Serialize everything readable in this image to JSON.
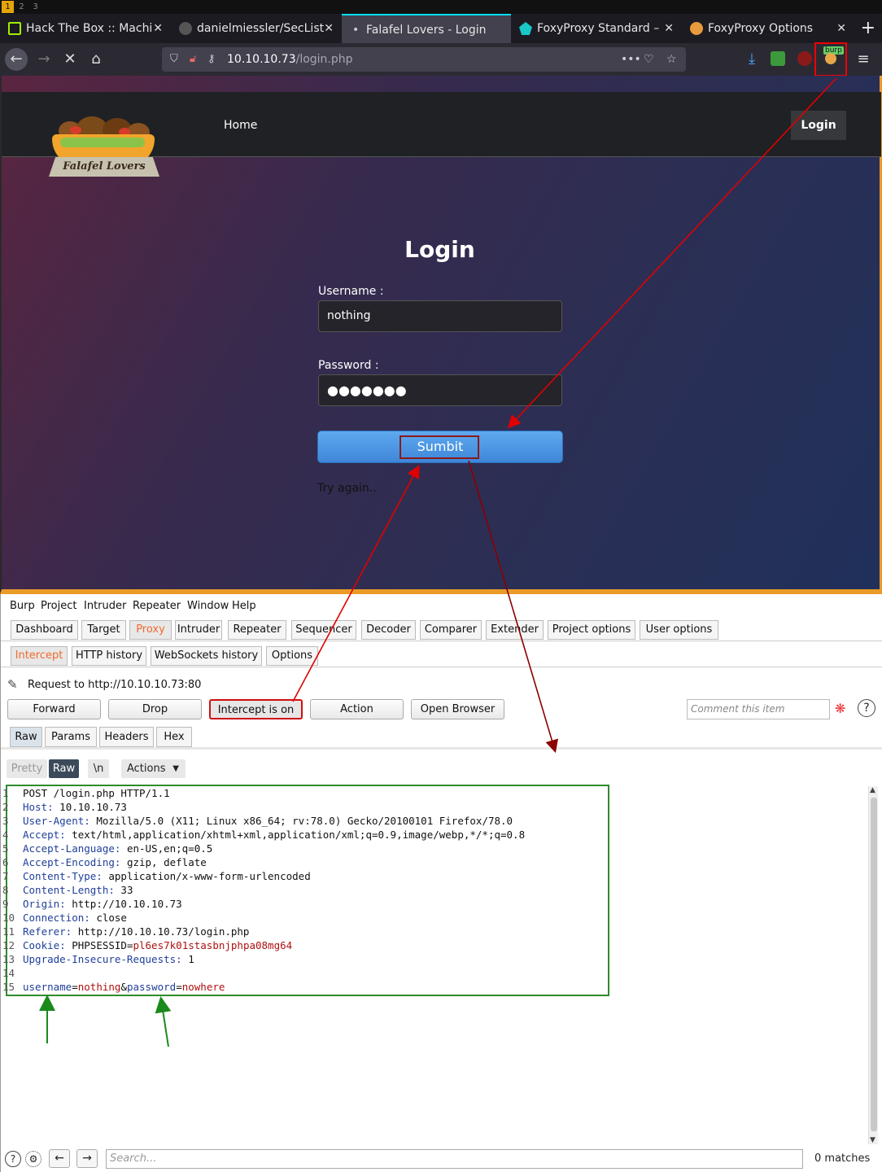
{
  "workspaces": [
    "1",
    "2",
    "3"
  ],
  "browser": {
    "tabs": [
      {
        "title": "Hack The Box :: Machi",
        "icon": "htb-cube-icon",
        "color": "#9fef00"
      },
      {
        "title": "danielmiessler/SecList",
        "icon": "github-icon",
        "color": "#cccccc"
      },
      {
        "title": "Falafel Lovers - Login",
        "icon": "loading-dot-icon",
        "color": "#e6e6e6"
      },
      {
        "title": "FoxyProxy Standard –",
        "icon": "foxyproxy-icon",
        "color": "#19c7c7"
      },
      {
        "title": "FoxyProxy Options",
        "icon": "foxyproxy-orange-icon",
        "color": "#e89a3c"
      }
    ],
    "url_host": "10.10.10.73",
    "url_path": "/login.php"
  },
  "site": {
    "logo_text": "Falafel Lovers",
    "nav_home": "Home",
    "nav_login": "Login",
    "title": "Login",
    "username_label": "Username :",
    "username_value": "nothing",
    "password_label": "Password :",
    "password_value": "●●●●●●●",
    "submit_label": "Sumbit",
    "message": "Try again.."
  },
  "burp": {
    "menu": [
      "Burp",
      "Project",
      "Intruder",
      "Repeater",
      "Window",
      "Help"
    ],
    "main_tabs": [
      "Dashboard",
      "Target",
      "Proxy",
      "Intruder",
      "Repeater",
      "Sequencer",
      "Decoder",
      "Comparer",
      "Extender",
      "Project options",
      "User options"
    ],
    "proxy_tabs": [
      "Intercept",
      "HTTP history",
      "WebSockets history",
      "Options"
    ],
    "request_label": "Request to http://10.10.10.73:80",
    "buttons": {
      "forward": "Forward",
      "drop": "Drop",
      "intercept": "Intercept is on",
      "action": "Action",
      "open_browser": "Open Browser"
    },
    "comment_placeholder": "Comment this item",
    "view_tabs": [
      "Raw",
      "Params",
      "Headers",
      "Hex"
    ],
    "editor_buttons": {
      "pretty": "Pretty",
      "raw": "Raw",
      "newline": "\\n",
      "actions": "Actions"
    },
    "request_lines": [
      {
        "n": "1",
        "plain": "POST /login.php HTTP/1.1"
      },
      {
        "n": "2",
        "key": "Host:",
        "value": " 10.10.10.73"
      },
      {
        "n": "3",
        "key": "User-Agent:",
        "value": " Mozilla/5.0 (X11; Linux x86_64; rv:78.0) Gecko/20100101 Firefox/78.0"
      },
      {
        "n": "4",
        "key": "Accept:",
        "value": " text/html,application/xhtml+xml,application/xml;q=0.9,image/webp,*/*;q=0.8"
      },
      {
        "n": "5",
        "key": "Accept-Language:",
        "value": " en-US,en;q=0.5"
      },
      {
        "n": "6",
        "key": "Accept-Encoding:",
        "value": " gzip, deflate"
      },
      {
        "n": "7",
        "key": "Content-Type:",
        "value": " application/x-www-form-urlencoded"
      },
      {
        "n": "8",
        "key": "Content-Length:",
        "value": " 33"
      },
      {
        "n": "9",
        "key": "Origin:",
        "value": " http://10.10.10.73"
      },
      {
        "n": "10",
        "key": "Connection:",
        "value": " close"
      },
      {
        "n": "11",
        "key": "Referer:",
        "value": " http://10.10.10.73/login.php"
      },
      {
        "n": "12",
        "key": "Cookie:",
        "value": " PHPSESSID=",
        "extra": "pl6es7k01stasbnjphpa08mg64"
      },
      {
        "n": "13",
        "key": "Upgrade-Insecure-Requests:",
        "value": " 1"
      },
      {
        "n": "14",
        "plain": ""
      },
      {
        "n": "15",
        "body": [
          {
            "t": "username",
            "c": "hk"
          },
          {
            "t": "=",
            "c": "val"
          },
          {
            "t": "nothing",
            "c": "pv"
          },
          {
            "t": "&",
            "c": "val"
          },
          {
            "t": "password",
            "c": "hk"
          },
          {
            "t": "=",
            "c": "val"
          },
          {
            "t": "nowhere",
            "c": "pv"
          }
        ]
      }
    ],
    "search_placeholder": "Search...",
    "matches": "0 matches"
  },
  "colors": {
    "burp_accent": "#f06a2b",
    "annotation_red": "#e00000",
    "annotation_darkred": "#8b0000",
    "annotation_green": "#1a8a1a"
  }
}
